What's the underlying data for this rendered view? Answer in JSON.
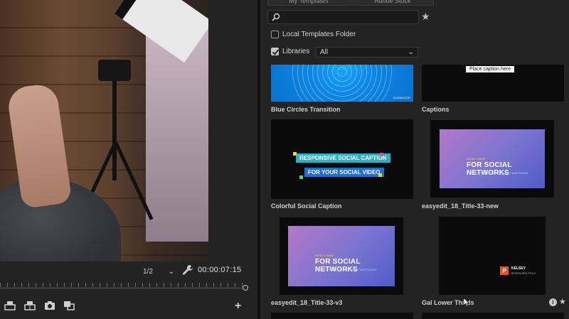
{
  "monitor": {
    "resolution": "1/2",
    "timecode": "00:00:07:15"
  },
  "panel": {
    "tabs": [
      "My Templates",
      "Adobe Stock"
    ],
    "search": {
      "value": "",
      "placeholder": ""
    },
    "local_folder": {
      "label": "Local Templates Folder",
      "checked": false
    },
    "libraries": {
      "label": "Libraries",
      "checked": true,
      "selected": "All"
    },
    "templates": [
      {
        "name": "Blue Circles Transition",
        "tag": "CLEARLOOP"
      },
      {
        "name": "Captions",
        "bubble": "Place caption here"
      },
      {
        "name": "Colorful Social Caption",
        "line1": "RESPONSIVE SOCIAL CAPTION",
        "line2": "FOR YOUR SOCIAL VIDEO"
      },
      {
        "name": "easyedit_18_Title-33-new",
        "kicker": "READY 1080P",
        "big": "FOR SOCIAL NETWORKS",
        "small": "LOREM IPSUM DOLOR SIT AMET ADIPISCING"
      },
      {
        "name": "easyedit_18_Title-33-v3",
        "kicker": "READY 1080P",
        "big": "FOR SOCIAL NETWORKS",
        "small": "LOREM IPSUM DOLOR SIT AMET ADIPISCING"
      },
      {
        "name": "Gal Lower Thirds",
        "logo": "P",
        "person": "KELSEY",
        "role": "INTERVIEW TITLE"
      }
    ]
  },
  "colors": {
    "panel_bg": "#232323",
    "blue_thumb": "#0c86e6",
    "caption_teal": "#2fb0c9",
    "caption_blue": "#1f6ed8",
    "purple_start": "#b478c8",
    "purple_end": "#4f5cc8",
    "lower_logo": "#e0542a"
  }
}
